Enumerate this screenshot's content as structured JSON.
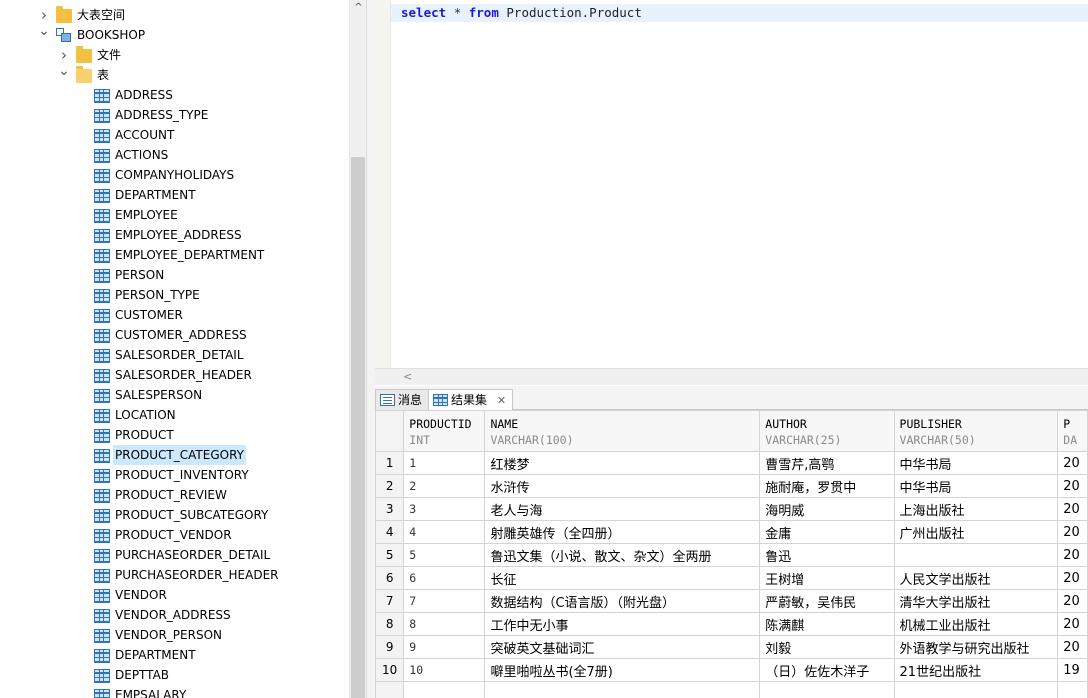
{
  "tree": {
    "items": [
      {
        "label": "大表空间",
        "icon": "folder-icon",
        "expanded": false,
        "indent": 0
      },
      {
        "label": "BOOKSHOP",
        "icon": "database-icon",
        "expanded": true,
        "indent": 0
      },
      {
        "label": "文件",
        "icon": "folder-icon",
        "expanded": false,
        "indent": 1
      },
      {
        "label": "表",
        "icon": "folder-open-icon",
        "expanded": true,
        "indent": 1
      }
    ],
    "tables": [
      "ADDRESS",
      "ADDRESS_TYPE",
      "ACCOUNT",
      "ACTIONS",
      "COMPANYHOLIDAYS",
      "DEPARTMENT",
      "EMPLOYEE",
      "EMPLOYEE_ADDRESS",
      "EMPLOYEE_DEPARTMENT",
      "PERSON",
      "PERSON_TYPE",
      "CUSTOMER",
      "CUSTOMER_ADDRESS",
      "SALESORDER_DETAIL",
      "SALESORDER_HEADER",
      "SALESPERSON",
      "LOCATION",
      "PRODUCT",
      "PRODUCT_CATEGORY",
      "PRODUCT_INVENTORY",
      "PRODUCT_REVIEW",
      "PRODUCT_SUBCATEGORY",
      "PRODUCT_VENDOR",
      "PURCHASEORDER_DETAIL",
      "PURCHASEORDER_HEADER",
      "VENDOR",
      "VENDOR_ADDRESS",
      "VENDOR_PERSON",
      "DEPARTMENT",
      "DEPTTAB",
      "EMPSALARY"
    ],
    "selected": "PRODUCT_CATEGORY"
  },
  "editor": {
    "kw_select": "select",
    "star": "*",
    "kw_from": "from",
    "object": "Production.Product"
  },
  "tabs": [
    {
      "label": "消息",
      "icon": "message-icon",
      "active": false
    },
    {
      "label": "结果集",
      "icon": "table-icon",
      "active": true,
      "close": "✕"
    }
  ],
  "grid": {
    "columns": [
      {
        "name": "PRODUCTID",
        "type": "INT"
      },
      {
        "name": "NAME",
        "type": "VARCHAR(100)"
      },
      {
        "name": "AUTHOR",
        "type": "VARCHAR(25)"
      },
      {
        "name": "PUBLISHER",
        "type": "VARCHAR(50)"
      },
      {
        "name": "P",
        "type": "DA"
      }
    ],
    "rows": [
      {
        "n": "1",
        "id": "1",
        "name": "红楼梦",
        "author": "曹雪芹,高鹗",
        "publisher": "中华书局",
        "extra": "20"
      },
      {
        "n": "2",
        "id": "2",
        "name": "水浒传",
        "author": "施耐庵，罗贯中",
        "publisher": "中华书局",
        "extra": "20"
      },
      {
        "n": "3",
        "id": "3",
        "name": "老人与海",
        "author": "海明威",
        "publisher": "上海出版社",
        "extra": "20"
      },
      {
        "n": "4",
        "id": "4",
        "name": "射雕英雄传（全四册）",
        "author": "金庸",
        "publisher": "广州出版社",
        "extra": "20"
      },
      {
        "n": "5",
        "id": "5",
        "name": "鲁迅文集（小说、散文、杂文）全两册",
        "author": "鲁迅",
        "publisher": "",
        "extra": "20"
      },
      {
        "n": "6",
        "id": "6",
        "name": "长征",
        "author": "王树增",
        "publisher": "人民文学出版社",
        "extra": "20"
      },
      {
        "n": "7",
        "id": "7",
        "name": "数据结构（C语言版）（附光盘）",
        "author": "严蔚敏，吴伟民",
        "publisher": "清华大学出版社",
        "extra": "20"
      },
      {
        "n": "8",
        "id": "8",
        "name": "工作中无小事",
        "author": "陈满麒",
        "publisher": "机械工业出版社",
        "extra": "20"
      },
      {
        "n": "9",
        "id": "9",
        "name": "突破英文基础词汇",
        "author": "刘毅",
        "publisher": "外语教学与研究出版社",
        "extra": "20"
      },
      {
        "n": "10",
        "id": "10",
        "name": "噼里啪啦丛书(全7册)",
        "author": "（日）佐佐木洋子",
        "publisher": "21世纪出版社",
        "extra": "19"
      }
    ]
  }
}
